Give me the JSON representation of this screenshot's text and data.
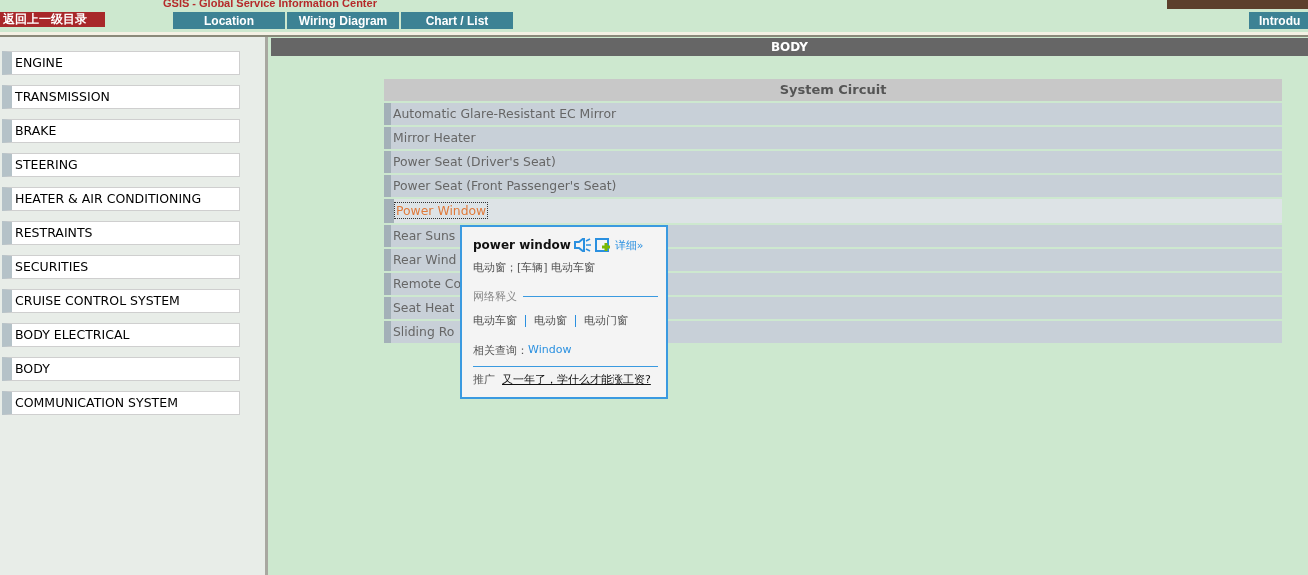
{
  "header": {
    "back_link": "返回上一级目录",
    "title": "GSIS - Global Service Information Center",
    "nav": [
      "Location",
      "Wiring Diagram",
      "Chart / List"
    ],
    "nav_right": "Introdu"
  },
  "sidebar": {
    "items": [
      {
        "label": "ENGINE"
      },
      {
        "label": "TRANSMISSION"
      },
      {
        "label": "BRAKE"
      },
      {
        "label": "STEERING"
      },
      {
        "label": "HEATER & AIR CONDITIONING"
      },
      {
        "label": "RESTRAINTS"
      },
      {
        "label": "SECURITIES"
      },
      {
        "label": "CRUISE CONTROL SYSTEM"
      },
      {
        "label": "BODY ELECTRICAL"
      },
      {
        "label": "BODY"
      },
      {
        "label": "COMMUNICATION SYSTEM"
      }
    ]
  },
  "main": {
    "title": "BODY",
    "table": {
      "header": "System Circuit",
      "rows": [
        {
          "label": "Automatic Glare-Resistant EC Mirror",
          "selected": false
        },
        {
          "label": "Mirror Heater",
          "selected": false
        },
        {
          "label": "Power Seat (Driver's Seat)",
          "selected": false
        },
        {
          "label": "Power Seat (Front Passenger's Seat)",
          "selected": false
        },
        {
          "label": "Power Window",
          "selected": true
        },
        {
          "label": "Rear Suns",
          "selected": false
        },
        {
          "label": "Rear Wind",
          "selected": false
        },
        {
          "label": "Remote Co",
          "selected": false
        },
        {
          "label": "Seat Heat",
          "selected": false
        },
        {
          "label": "Sliding Ro",
          "selected": false
        }
      ]
    }
  },
  "popup": {
    "word": "power window",
    "details_link": "详细»",
    "definition": "电动窗；[车辆] 电动车窗",
    "web_heading": "网络释义",
    "web_terms": [
      "电动车窗",
      "电动窗",
      "电动门窗"
    ],
    "related_label": "相关查询：",
    "related_link": "Window",
    "promo_label": "推广",
    "promo_link": "又一年了，学什么才能涨工资?"
  }
}
